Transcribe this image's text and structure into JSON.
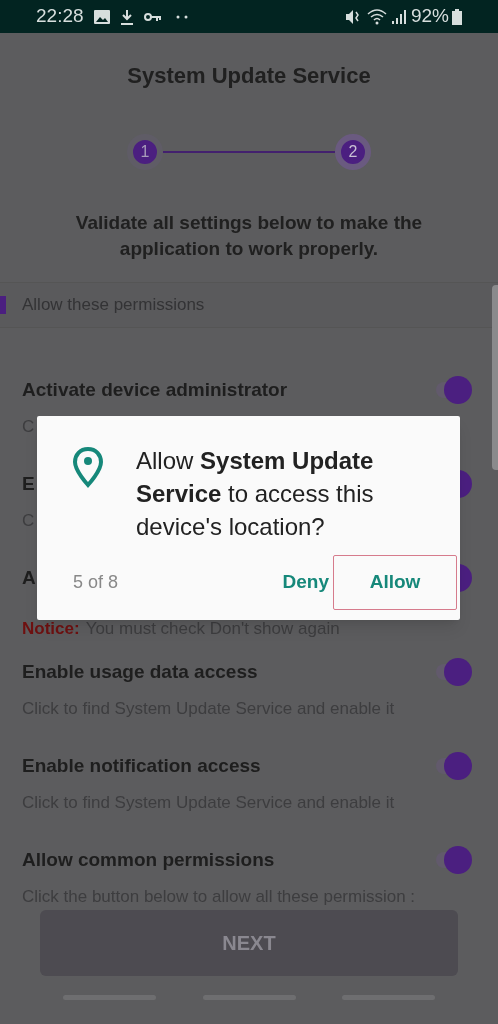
{
  "status_bar": {
    "time": "22:28",
    "battery": "92%"
  },
  "header": {
    "title": "System Update Service"
  },
  "stepper": {
    "steps": [
      {
        "label": "1",
        "selected": false
      },
      {
        "label": "2",
        "selected": true
      }
    ]
  },
  "intro": "Validate all settings below to make the application to work properly.",
  "section": {
    "title": "Allow these permissions"
  },
  "rows": [
    {
      "title": "Activate device administrator",
      "on": true,
      "desc": {
        "kind": "text",
        "text": "C"
      }
    },
    {
      "title": "E",
      "on": true,
      "desc": {
        "kind": "text",
        "text": "C"
      }
    },
    {
      "title": "A",
      "on": true,
      "desc": {
        "kind": "notice",
        "label": "Notice:",
        "text": "You must check Don't show again"
      }
    },
    {
      "title": "Enable usage data access",
      "on": true,
      "desc": {
        "kind": "text",
        "text": "Click to find System Update Service and enable it"
      }
    },
    {
      "title": "Enable notification access",
      "on": true,
      "desc": {
        "kind": "text",
        "text": "Click to find System Update Service and enable it"
      }
    },
    {
      "title": "Allow common permissions",
      "on": true,
      "desc": {
        "kind": "text",
        "text": "Click the button below to allow all these permission :"
      }
    }
  ],
  "next_button": {
    "label": "NEXT",
    "disabled": true
  },
  "dialog": {
    "message": "Allow **System Update Service** to access this device's location?",
    "counter": "5 of 8",
    "deny": "Deny",
    "allow": "Allow"
  }
}
